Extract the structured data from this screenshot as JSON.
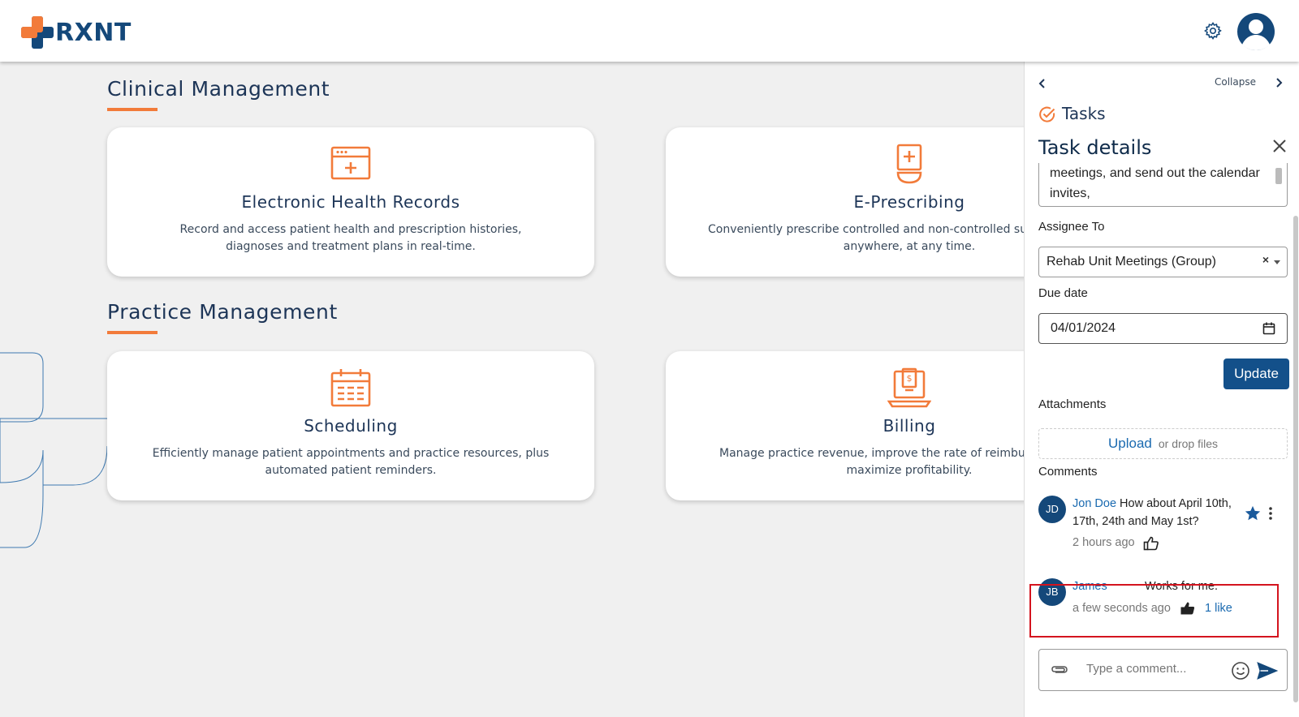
{
  "header": {
    "logo_text": "RXNT",
    "settings_icon": "gear-icon",
    "profile_icon": "user-avatar-icon"
  },
  "sections": [
    {
      "title": "Clinical Management",
      "cards": [
        {
          "icon": "ehr-calendar-plus-icon",
          "title": "Electronic Health Records",
          "description": "Record and access patient health and prescription histories, diagnoses and treatment plans in real-time."
        },
        {
          "icon": "prescription-bottle-icon",
          "title": "E-Prescribing",
          "description_line1": "Conveniently prescribe controlled and non-controlled su",
          "description_line2": "anywhere, at any time."
        }
      ]
    },
    {
      "title": "Practice Management",
      "cards": [
        {
          "icon": "calendar-icon",
          "title": "Scheduling",
          "description": "Efficiently manage patient appointments and practice resources, plus automated patient reminders."
        },
        {
          "icon": "billing-laptop-icon",
          "title": "Billing",
          "description_line1": "Manage practice revenue, improve the rate of reimbu",
          "description_line2": "maximize profitability."
        }
      ]
    }
  ],
  "panel": {
    "collapse_label": "Collapse",
    "tasks_label": "Tasks",
    "title": "Task details",
    "description_visible": "meetings, and send out the calendar invites,",
    "assignee_label": "Assignee To",
    "assignee_value": "Rehab Unit Meetings (Group)",
    "assignee_clear": "×",
    "due_date_label": "Due date",
    "due_date_value": "04/01/2024",
    "update_label": "Update",
    "attachments_label": "Attachments",
    "upload_link": "Upload",
    "upload_hint": "or drop files",
    "comments_label": "Comments",
    "comments": [
      {
        "initials": "JD",
        "author": "Jon Doe",
        "text_line1": "How about April 10th,",
        "text_line2": "17th, 24th and May 1st?",
        "time": "2 hours ago",
        "likes": "",
        "liked": false
      },
      {
        "initials": "JB",
        "author": "James",
        "text_line1": "Works for me.",
        "time": "a few seconds ago",
        "likes": "1 like",
        "liked": true
      }
    ],
    "comment_placeholder": "Type a comment...",
    "accent_color": "#13508a",
    "highlight_color": "#d4141e"
  }
}
